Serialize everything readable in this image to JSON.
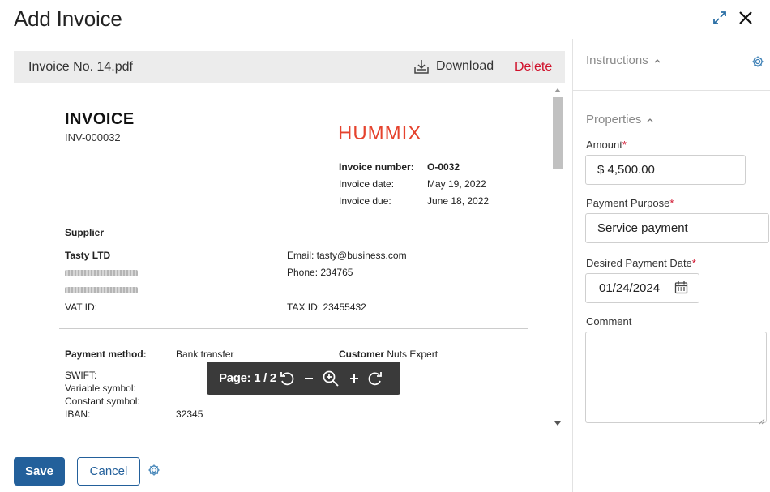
{
  "header": {
    "title": "Add Invoice",
    "icons": [
      "expand-icon",
      "close-icon"
    ]
  },
  "viewer": {
    "file_name": "Invoice No. 14.pdf",
    "download_label": "Download",
    "delete_label": "Delete",
    "page_label": "Page: 1 / 2",
    "toolbar_icons": [
      "rotate-left-icon",
      "zoom-out-icon",
      "zoom-icon",
      "zoom-in-icon",
      "rotate-right-icon"
    ]
  },
  "document": {
    "title": "INVOICE",
    "number": "INV-000032",
    "logo_text": "HUMMIX",
    "meta": [
      {
        "label": "Invoice number:",
        "value": "O-0032"
      },
      {
        "label": "Invoice date:",
        "value": "May 19, 2022"
      },
      {
        "label": "Invoice due:",
        "value": "June 18, 2022"
      }
    ],
    "supplier_heading": "Supplier",
    "supplier_name": "Tasty LTD",
    "email": "Email: tasty@business.com",
    "phone": "Phone: 234765",
    "vat": "VAT ID:",
    "tax": "TAX ID: 23455432",
    "payment_method_label": "Payment method:",
    "payment_method_value": "Bank transfer",
    "customer_label": "Customer",
    "customer_value": "Nuts Expert",
    "swift": "SWIFT:",
    "variable_symbol": "Variable symbol:",
    "constant_symbol": "Constant symbol:",
    "iban": "IBAN:",
    "iban_value": "32345"
  },
  "footer": {
    "save_label": "Save",
    "cancel_label": "Cancel"
  },
  "sidebar": {
    "instructions_label": "Instructions",
    "properties_label": "Properties",
    "fields": {
      "amount": {
        "label": "Amount",
        "value": "$ 4,500.00",
        "required": true
      },
      "purpose": {
        "label": "Payment Purpose",
        "value": "Service payment",
        "required": true
      },
      "date": {
        "label": "Desired Payment Date",
        "value": "01/24/2024",
        "required": true
      },
      "comment": {
        "label": "Comment",
        "value": ""
      }
    },
    "required_mark": "*"
  },
  "colors": {
    "primary": "#23609b",
    "danger": "#d0112b",
    "logo": "#e5432e",
    "icon_blue": "#3b7fb5"
  }
}
